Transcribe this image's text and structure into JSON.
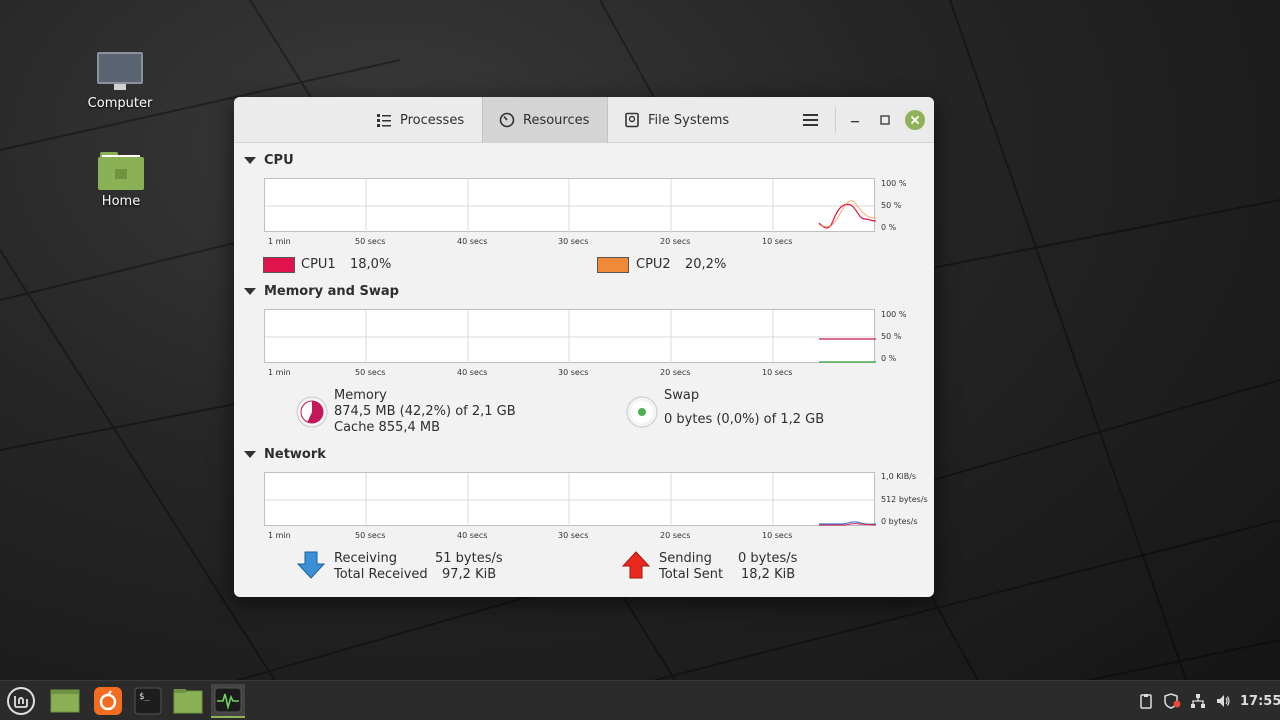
{
  "desktop": {
    "icons": [
      {
        "label": "Computer"
      },
      {
        "label": "Home"
      }
    ]
  },
  "window": {
    "tabs": [
      {
        "label": "Processes",
        "icon": "list-icon"
      },
      {
        "label": "Resources",
        "icon": "gauge-icon",
        "active": true
      },
      {
        "label": "File Systems",
        "icon": "disk-icon"
      }
    ],
    "cpu": {
      "heading": "CPU",
      "y_labels": [
        "100 %",
        "50 %",
        "0 %"
      ],
      "x_labels": [
        "1 min",
        "50 secs",
        "40 secs",
        "30 secs",
        "20 secs",
        "10 secs"
      ],
      "cpu1": {
        "label": "CPU1",
        "value": "18,0%",
        "color": "#e0144c"
      },
      "cpu2": {
        "label": "CPU2",
        "value": "20,2%",
        "color": "#f08a38"
      }
    },
    "memory": {
      "heading": "Memory and Swap",
      "y_labels": [
        "100 %",
        "50 %",
        "0 %"
      ],
      "x_labels": [
        "1 min",
        "50 secs",
        "40 secs",
        "30 secs",
        "20 secs",
        "10 secs"
      ],
      "mem_label": "Memory",
      "mem_value": "874,5 MB (42,2%) of 2,1 GB",
      "mem_cache": "Cache 855,4 MB",
      "swap_label": "Swap",
      "swap_value": "0 bytes (0,0%) of 1,2 GB",
      "mem_color": "#c2185b",
      "swap_color": "#4caf50"
    },
    "network": {
      "heading": "Network",
      "y_labels": [
        "1,0 KiB/s",
        "512 bytes/s",
        "0 bytes/s"
      ],
      "x_labels": [
        "1 min",
        "50 secs",
        "40 secs",
        "30 secs",
        "20 secs",
        "10 secs"
      ],
      "receiving_label": "Receiving",
      "receiving_value": "51 bytes/s",
      "total_received_label": "Total Received",
      "total_received_value": "97,2 KiB",
      "sending_label": "Sending",
      "sending_value": "0 bytes/s",
      "total_sent_label": "Total Sent",
      "total_sent_value": "18,2 KiB"
    }
  },
  "taskbar": {
    "clock": "17:55"
  }
}
